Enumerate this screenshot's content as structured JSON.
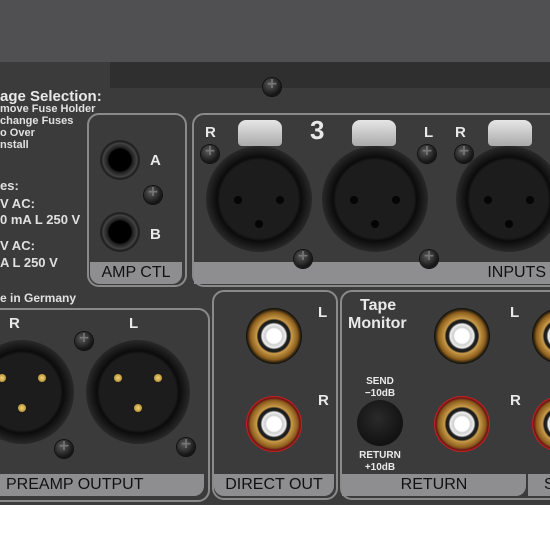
{
  "voltage": {
    "title": "age Selection:",
    "steps": [
      "move Fuse Holder",
      "change Fuses",
      "o Over",
      "nstall"
    ]
  },
  "fuses": {
    "title": "es:",
    "rating1_a": "V AC:",
    "rating1_b": "0 mA L 250 V",
    "rating2_a": "V AC:",
    "rating2_b": "A L 250 V"
  },
  "made_in": "e in Germany",
  "amp_ctl": {
    "label": "AMP CTL",
    "a": "A",
    "b": "B"
  },
  "inputs": {
    "label": "INPUTS",
    "number": "3",
    "r": "R",
    "l": "L",
    "r2": "R"
  },
  "preamp_output": {
    "label": "PREAMP OUTPUT",
    "r": "R",
    "l": "L"
  },
  "direct_out": {
    "label": "DIRECT OUT",
    "l": "L",
    "r": "R"
  },
  "tape_monitor": {
    "title_line1": "Tape",
    "title_line2": "Monitor",
    "send_line1": "SEND",
    "send_line2": "−10dB",
    "return_line1": "RETURN",
    "return_line2": "+10dB",
    "l": "L",
    "r": "R",
    "label": "RETURN",
    "next_label": "S"
  },
  "colors": {
    "panel": "#3b3b3c",
    "frame": "#8a8a8a",
    "label_bar": "#8e8e90",
    "gold": "#c89a49",
    "red_ring": "#c22222"
  }
}
